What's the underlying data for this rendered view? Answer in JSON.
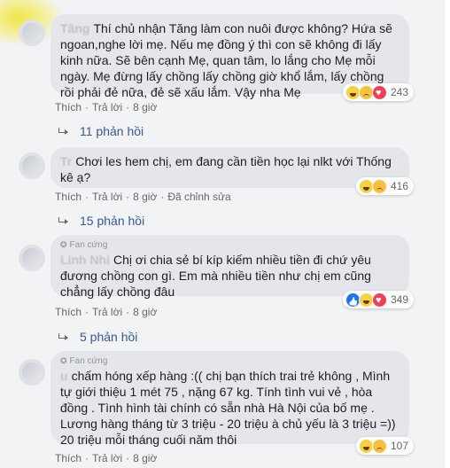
{
  "comments": [
    {
      "author": "Tăng",
      "badge": "",
      "text": "Thí chủ nhận Tăng làm con nuôi được không? Hứa sẽ ngoan,nghe lời mẹ. Nếu mẹ đồng ý thì con sẽ không đi lấy kinh nữa. Sẽ bên cạnh Mẹ, quan tâm, lo lắng cho Mẹ mỗi ngày. Mẹ đừng lấy chồng lấy chồng giờ khổ lắm, lấy chồng rồi phải đẻ nữa, đẻ sẽ xấu lắm. Vậy nha Mẹ",
      "reaction_count": "243",
      "reactions": [
        "haha-icon",
        "wow-icon",
        "love-icon"
      ],
      "like": "Thích",
      "reply": "Trả lời",
      "time": "8 giờ",
      "edited": "",
      "replies": "11 phản hồi"
    },
    {
      "author": "Tr",
      "badge": "",
      "text": "Chơi les hem chị, em đang cần tiền học lại nlkt với Thống kê ạ?",
      "reaction_count": "416",
      "reactions": [
        "haha-icon",
        "sad-icon"
      ],
      "like": "Thích",
      "reply": "Trả lời",
      "time": "8 giờ",
      "edited": "Đã chỉnh sửa",
      "replies": "15 phản hồi"
    },
    {
      "author": "Linh Nhi",
      "badge": "Fan cứng",
      "text": "Chị ơi chia sẻ bí kíp kiếm nhiều tiền đi chứ yêu đương chồng con gì. Em mà nhiều tiền như chị em cũng chẳng lấy chồng đâu",
      "reaction_count": "349",
      "reactions": [
        "like-icon",
        "haha-icon",
        "love-icon"
      ],
      "like": "Thích",
      "reply": "Trả lời",
      "time": "8 giờ",
      "edited": "",
      "replies": "5 phản hồi"
    },
    {
      "author": "u",
      "badge": "Fan cứng",
      "text": "chấm hóng xếp hàng :(( chị bạn thích trai trẻ không , Mình tự giới thiệu 1 mét 75 , nặng 67 kg. Tính tình vui vẻ , hòa đồng . Tình hình tài chính có sẵn nhà Hà Nội của bố mẹ . Lương hàng tháng từ 3 triệu - 20 triệu à chủ yếu là 3 triệu =)) 20 triệu mỗi tháng cuối năm thôi",
      "reaction_count": "107",
      "reactions": [
        "haha-icon",
        "sad-icon"
      ],
      "like": "Thích",
      "reply": "Trả lời",
      "time": "8 giờ",
      "edited": "",
      "replies": ""
    }
  ],
  "colors": {
    "bubble": "#e4e6eb",
    "link": "#385898",
    "meta": "#65676b"
  }
}
